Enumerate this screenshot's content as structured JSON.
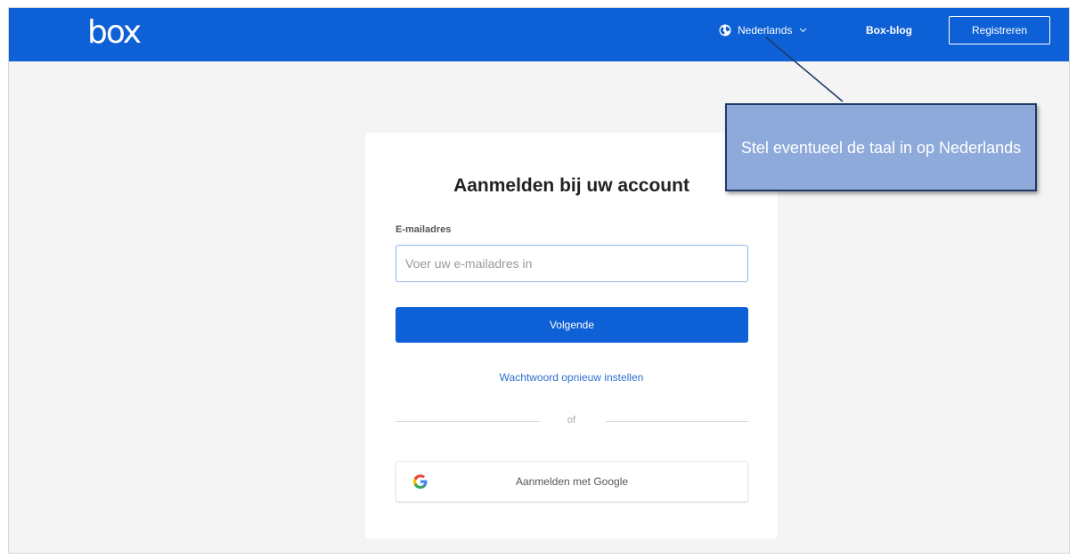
{
  "header": {
    "logo": "box",
    "language": "Nederlands",
    "blog_label": "Box-blog",
    "register_label": "Registreren"
  },
  "login": {
    "title": "Aanmelden bij uw account",
    "email_label": "E-mailadres",
    "email_placeholder": "Voer uw e-mailadres in",
    "email_value": "",
    "next_label": "Volgende",
    "reset_link": "Wachtwoord opnieuw instellen",
    "or_label": "of",
    "google_label": "Aanmelden met Google"
  },
  "callout": {
    "text": "Stel eventueel de taal in op Nederlands"
  },
  "colors": {
    "brand_blue": "#0d60d6",
    "callout_fill": "#8eaadb",
    "callout_border": "#1f3864"
  },
  "icons": {
    "language": "globe-icon",
    "dropdown": "chevron-down-icon",
    "google": "google-icon"
  }
}
